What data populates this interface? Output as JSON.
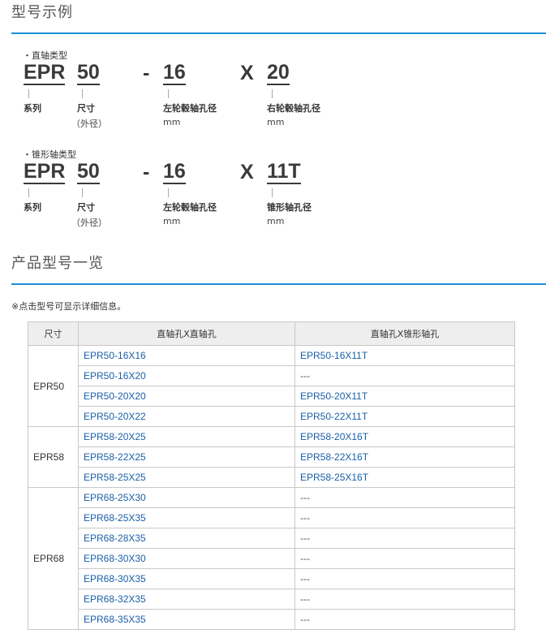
{
  "section1_title": "型号示例",
  "examples": [
    {
      "type_label": "・直轴类型",
      "series": "EPR",
      "size": "50",
      "dash": "-",
      "left_bore": "16",
      "times": "X",
      "right_bore": "20",
      "cap_series": "系列",
      "cap_size": "尺寸",
      "cap_size_sub": "（外径）",
      "cap_left": "左轮毂轴孔径",
      "cap_left_unit": "mm",
      "cap_right": "右轮毂轴孔径",
      "cap_right_unit": "mm"
    },
    {
      "type_label": "・锥形轴类型",
      "series": "EPR",
      "size": "50",
      "dash": "-",
      "left_bore": "16",
      "times": "X",
      "right_bore": "11T",
      "cap_series": "系列",
      "cap_size": "尺寸",
      "cap_size_sub": "（外径）",
      "cap_left": "左轮毂轴孔径",
      "cap_left_unit": "mm",
      "cap_right": "锥形轴孔径",
      "cap_right_unit": "mm"
    }
  ],
  "section2_title": "产品型号一览",
  "note": "※点击型号可显示详细信息。",
  "table": {
    "headers": [
      "尺寸",
      "直轴孔X直轴孔",
      "直轴孔X锥形轴孔"
    ],
    "groups": [
      {
        "size": "EPR50",
        "rows": [
          [
            "EPR50-16X16",
            "EPR50-16X11T"
          ],
          [
            "EPR50-16X20",
            "---"
          ],
          [
            "EPR50-20X20",
            "EPR50-20X11T"
          ],
          [
            "EPR50-20X22",
            "EPR50-22X11T"
          ]
        ]
      },
      {
        "size": "EPR58",
        "rows": [
          [
            "EPR58-20X25",
            "EPR58-20X16T"
          ],
          [
            "EPR58-22X25",
            "EPR58-22X16T"
          ],
          [
            "EPR58-25X25",
            "EPR58-25X16T"
          ]
        ]
      },
      {
        "size": "EPR68",
        "rows": [
          [
            "EPR68-25X30",
            "---"
          ],
          [
            "EPR68-25X35",
            "---"
          ],
          [
            "EPR68-28X35",
            "---"
          ],
          [
            "EPR68-30X30",
            "---"
          ],
          [
            "EPR68-30X35",
            "---"
          ],
          [
            "EPR68-32X35",
            "---"
          ],
          [
            "EPR68-35X35",
            "---"
          ]
        ]
      }
    ]
  }
}
